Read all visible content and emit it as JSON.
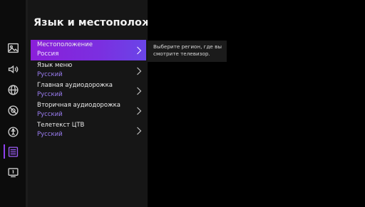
{
  "panel": {
    "title": "Язык и местоположени"
  },
  "sidebar": {
    "icons": [
      {
        "name": "picture-icon"
      },
      {
        "name": "sound-icon"
      },
      {
        "name": "network-icon"
      },
      {
        "name": "accessibility-settings-icon"
      },
      {
        "name": "accessibility-icon"
      },
      {
        "name": "system-icon",
        "active": true
      },
      {
        "name": "device-info-icon"
      }
    ]
  },
  "menu": {
    "items": [
      {
        "label": "Местоположение",
        "value": "Россия",
        "active": true
      },
      {
        "label": "Язык меню",
        "value": "Русский"
      },
      {
        "label": "Главная аудиодорожка",
        "value": "Русский"
      },
      {
        "label": "Вторичная аудиодорожка",
        "value": "Русский"
      },
      {
        "label": "Телетекст ЦТВ",
        "value": "Русский"
      }
    ]
  },
  "tooltip": {
    "text": "Выберите регион, где вы смотрите телевизор."
  },
  "colors": {
    "accent": "#8a1fd9",
    "value_text": "#9b7df2",
    "background": "#000000"
  }
}
